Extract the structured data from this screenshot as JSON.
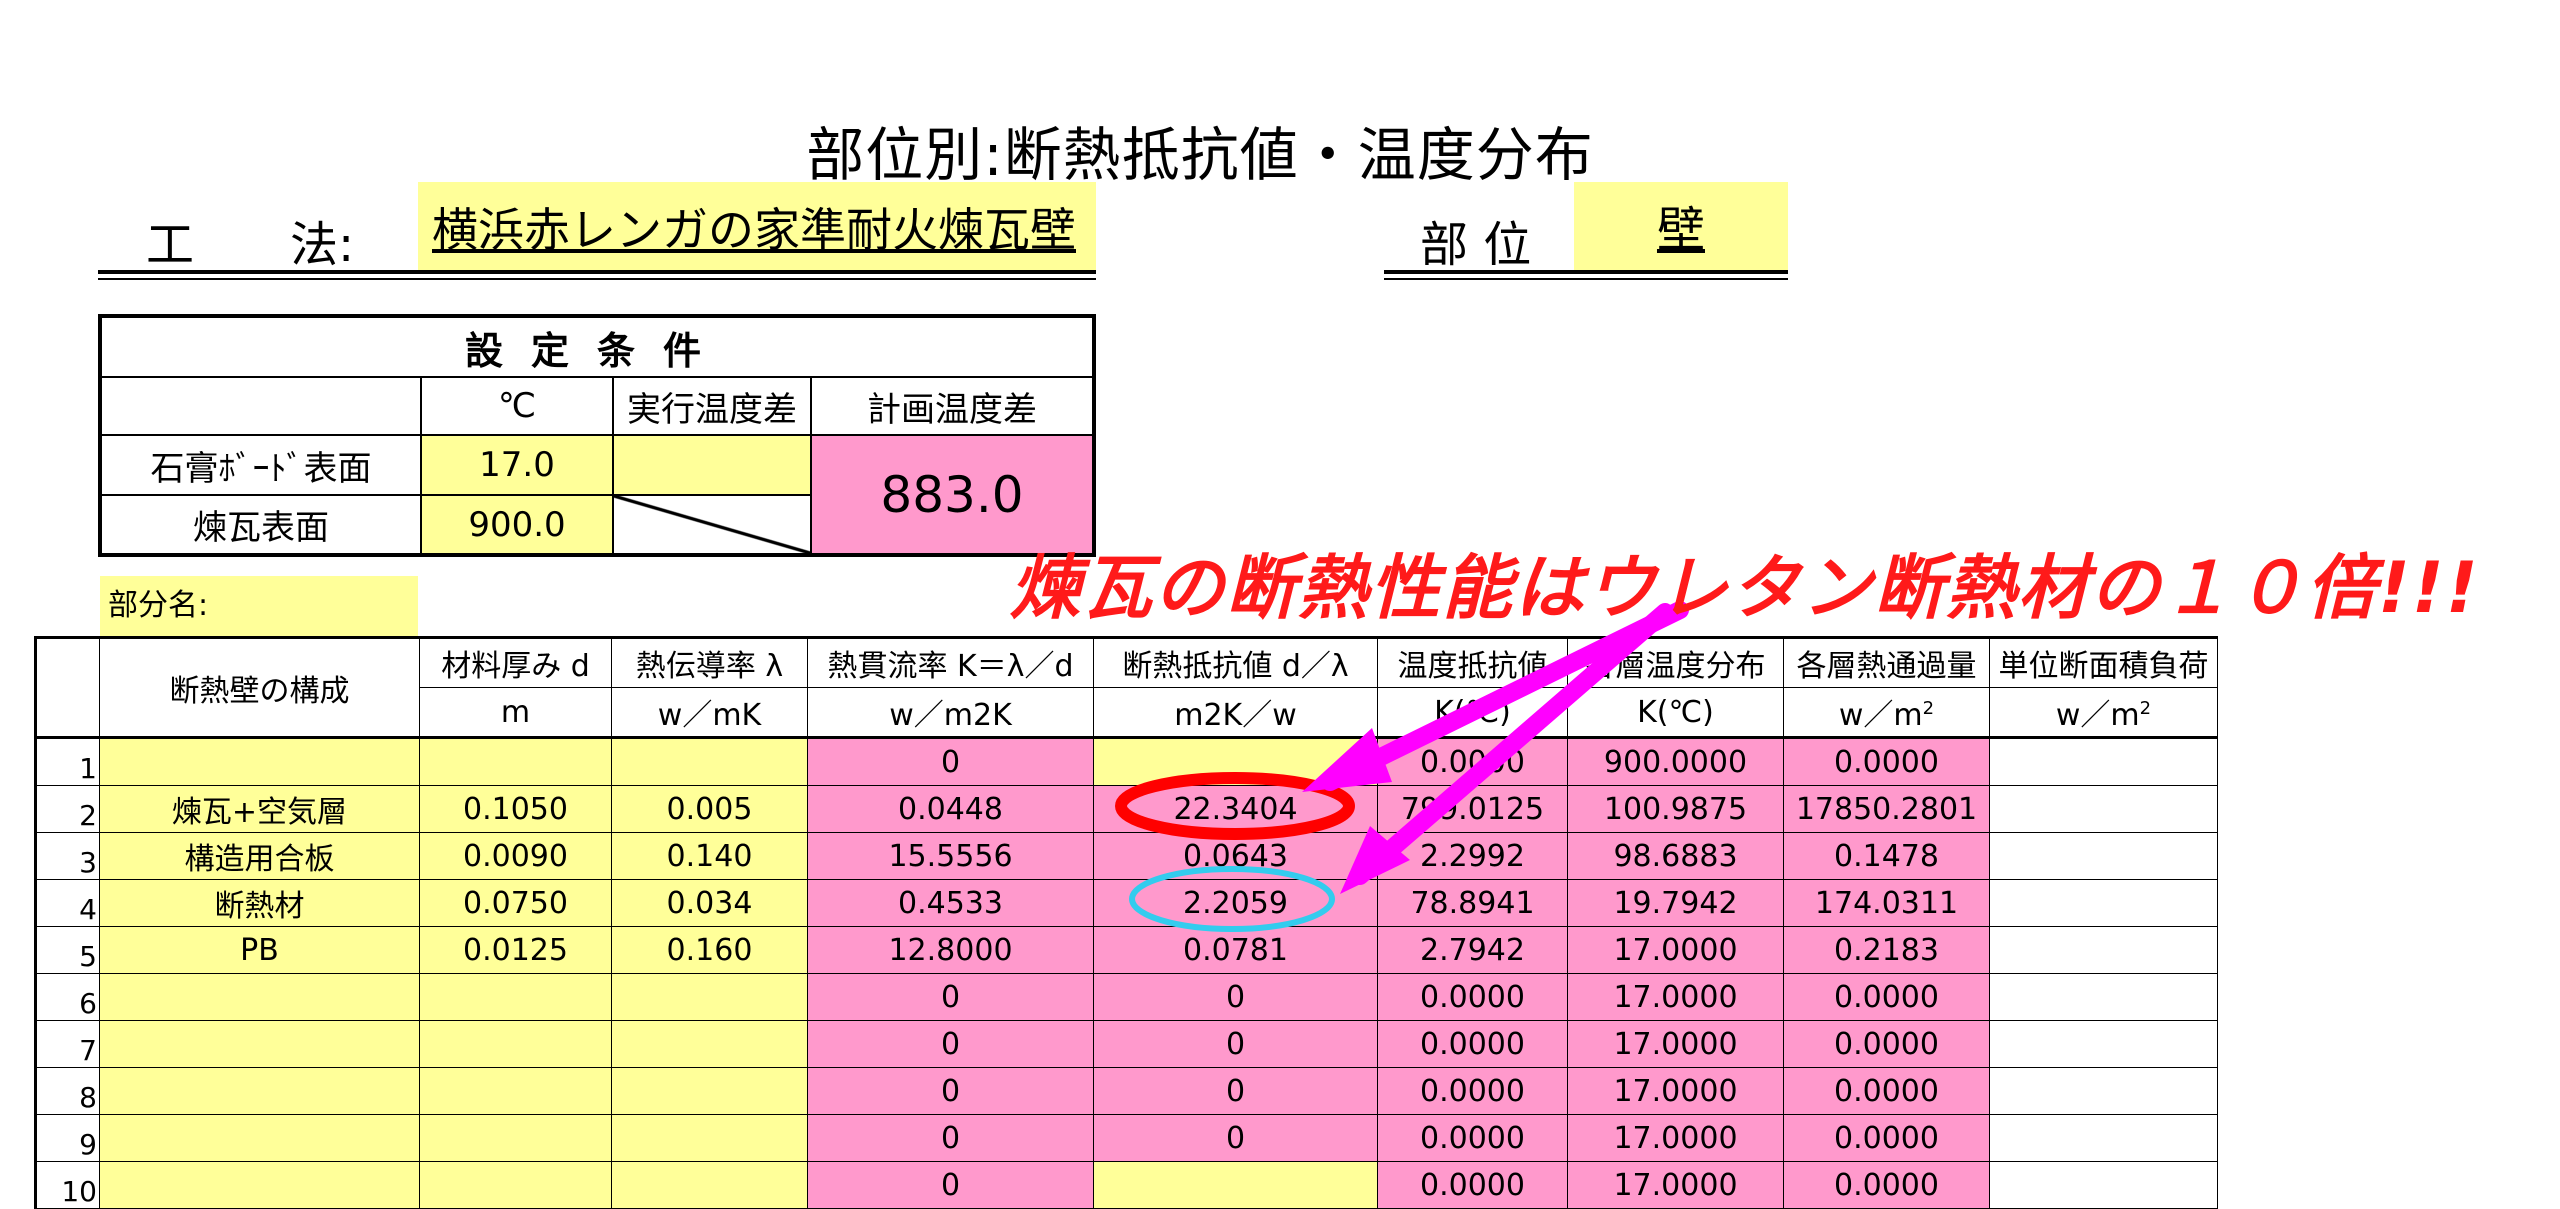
{
  "title": "部位別:断熱抵抗値・温度分布",
  "method_label": "工　　法:",
  "method_value": "横浜赤レンガの家準耐火煉瓦壁",
  "part_label": "部 位",
  "part_value": "壁",
  "conditions": {
    "heading": "設定条件",
    "col_unit": "℃",
    "col_exec": "実行温度差",
    "col_plan": "計画温度差",
    "rows": [
      {
        "label": "石膏ﾎﾞｰﾄﾞ表面",
        "temp": "17.0"
      },
      {
        "label": "煉瓦表面",
        "temp": "900.0"
      }
    ],
    "plan_diff": "883.0"
  },
  "subname_label": "部分名:",
  "table": {
    "header_top": [
      "断熱壁の構成",
      "材料厚み d",
      "熱伝導率 λ",
      "熱貫流率 K＝λ／d",
      "断熱抵抗値 d／λ",
      "温度抵抗値",
      "各層温度分布",
      "各層熱通過量",
      "単位断面積負荷"
    ],
    "header_units": [
      "m",
      "w／mK",
      "w／m2K",
      "m2K／w",
      "K(℃)",
      "K(℃)",
      "w／m",
      "w／m"
    ],
    "unit_sup": "2",
    "rows": [
      {
        "n": "1",
        "name": "",
        "d": "",
        "lam": "",
        "k": "0",
        "r": "",
        "tr": "0.0000",
        "temp": "900.0000",
        "q": "0.0000"
      },
      {
        "n": "2",
        "name": "煉瓦+空気層",
        "d": "0.1050",
        "lam": "0.005",
        "k": "0.0448",
        "r": "22.3404",
        "tr": "799.0125",
        "temp": "100.9875",
        "q": "17850.2801"
      },
      {
        "n": "3",
        "name": "構造用合板",
        "d": "0.0090",
        "lam": "0.140",
        "k": "15.5556",
        "r": "0.0643",
        "tr": "2.2992",
        "temp": "98.6883",
        "q": "0.1478"
      },
      {
        "n": "4",
        "name": "断熱材",
        "d": "0.0750",
        "lam": "0.034",
        "k": "0.4533",
        "r": "2.2059",
        "tr": "78.8941",
        "temp": "19.7942",
        "q": "174.0311"
      },
      {
        "n": "5",
        "name": "PB",
        "d": "0.0125",
        "lam": "0.160",
        "k": "12.8000",
        "r": "0.0781",
        "tr": "2.7942",
        "temp": "17.0000",
        "q": "0.2183"
      },
      {
        "n": "6",
        "name": "",
        "d": "",
        "lam": "",
        "k": "0",
        "r": "0",
        "tr": "0.0000",
        "temp": "17.0000",
        "q": "0.0000"
      },
      {
        "n": "7",
        "name": "",
        "d": "",
        "lam": "",
        "k": "0",
        "r": "0",
        "tr": "0.0000",
        "temp": "17.0000",
        "q": "0.0000"
      },
      {
        "n": "8",
        "name": "",
        "d": "",
        "lam": "",
        "k": "0",
        "r": "0",
        "tr": "0.0000",
        "temp": "17.0000",
        "q": "0.0000"
      },
      {
        "n": "9",
        "name": "",
        "d": "",
        "lam": "",
        "k": "0",
        "r": "0",
        "tr": "0.0000",
        "temp": "17.0000",
        "q": "0.0000"
      },
      {
        "n": "10",
        "name": "",
        "d": "",
        "lam": "",
        "k": "0",
        "r": "",
        "tr": "0.0000",
        "temp": "17.0000",
        "q": "0.0000"
      }
    ]
  },
  "annotation": {
    "caption": "煉瓦の断熱性能はウレタン断熱材の１０倍!!!",
    "caption_color": "#ff1a1a",
    "arrow_color": "#ff00ff",
    "highlight_red": "#ff0000",
    "highlight_cyan": "#33ccee"
  }
}
